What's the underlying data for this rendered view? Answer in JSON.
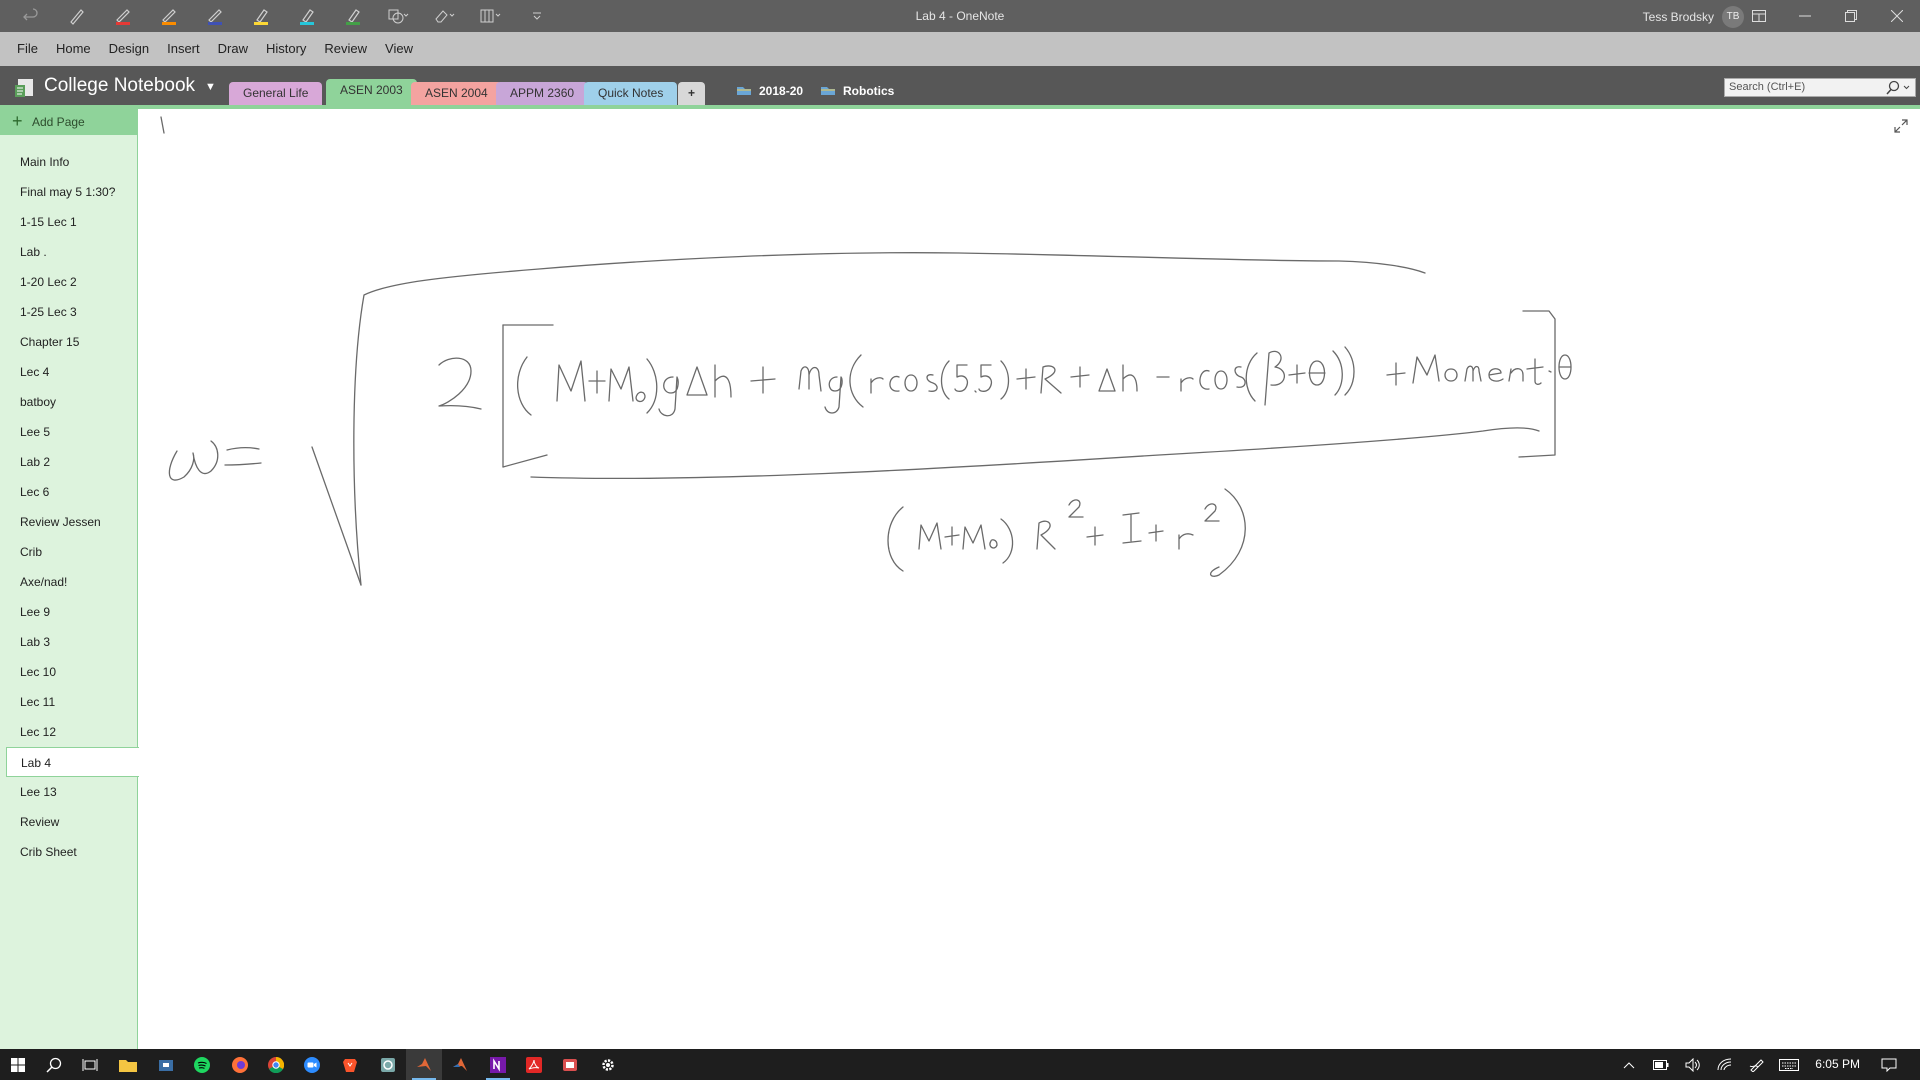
{
  "window": {
    "title": "Lab 4  -  OneNote",
    "user_name": "Tess Brodsky",
    "user_initials": "TB"
  },
  "quick_access": [
    {
      "icon": "undo-icon"
    },
    {
      "icon": "pen-icon",
      "color": "#bdbdbd"
    },
    {
      "icon": "pen-icon",
      "color": "#e53935"
    },
    {
      "icon": "pen-icon",
      "color": "#fb8c00"
    },
    {
      "icon": "pen-icon",
      "color": "#3f51b5"
    },
    {
      "icon": "highlighter-icon",
      "color": "#fdd835"
    },
    {
      "icon": "highlighter-icon",
      "color": "#26c6da"
    },
    {
      "icon": "highlighter-icon",
      "color": "#43a047"
    },
    {
      "icon": "shapes-icon"
    },
    {
      "icon": "eraser-icon"
    },
    {
      "icon": "ruler-icon"
    },
    {
      "icon": "customize-qat-icon"
    }
  ],
  "menu": [
    "File",
    "Home",
    "Design",
    "Insert",
    "Draw",
    "History",
    "Review",
    "View"
  ],
  "notebook": {
    "name": "College Notebook"
  },
  "sections": [
    {
      "label": "General Life",
      "color": "#d8a8d8",
      "active": false
    },
    {
      "label": "ASEN 2003",
      "color": "#8fd39a",
      "active": true
    },
    {
      "label": "ASEN 2004",
      "color": "#f4a3a0",
      "active": false
    },
    {
      "label": "APPM 2360",
      "color": "#c8a6d8",
      "active": false
    },
    {
      "label": "Quick Notes",
      "color": "#9fd0ea",
      "active": false
    }
  ],
  "add_section": "+",
  "section_groups": [
    "2018-20",
    "Robotics"
  ],
  "search": {
    "placeholder": "Search (Ctrl+E)"
  },
  "add_page_label": "Add Page",
  "pages": [
    "Main Info",
    "Final may 5 1:30?",
    "1-15 Lec 1",
    "Lab .",
    "1-20 Lec 2",
    "1-25 Lec 3",
    "Chapter 15",
    "Lec 4",
    "batboy",
    "Lee 5",
    "Lab 2",
    "Lec 6",
    "Review Jessen",
    "Crib",
    "Axe/nad!",
    "Lee 9",
    "Lab 3",
    "Lec 10",
    "Lec 11",
    "Lec 12",
    "Lab 4",
    "Lee 13",
    "Review",
    "Crib Sheet"
  ],
  "active_page": "Lab 4",
  "colors": {
    "accent_green": "#8fd39a",
    "pagelist_bg": "#ddf3dd",
    "titlebar": "#5f5f5f",
    "menubar": "#c2c2c2",
    "navbar": "#575757"
  },
  "taskbar": {
    "apps": [
      "start-icon",
      "search-icon",
      "task-view-icon",
      "file-explorer-icon",
      "store-icon",
      "spotify-icon",
      "firefox-icon",
      "chrome-icon",
      "zoom-icon",
      "brave-icon",
      "app-icon",
      "matlab-icon",
      "matlab-icon-2",
      "onenote-icon",
      "acrobat-icon",
      "app-red-icon",
      "settings-icon"
    ],
    "clock": "6:05 PM"
  }
}
